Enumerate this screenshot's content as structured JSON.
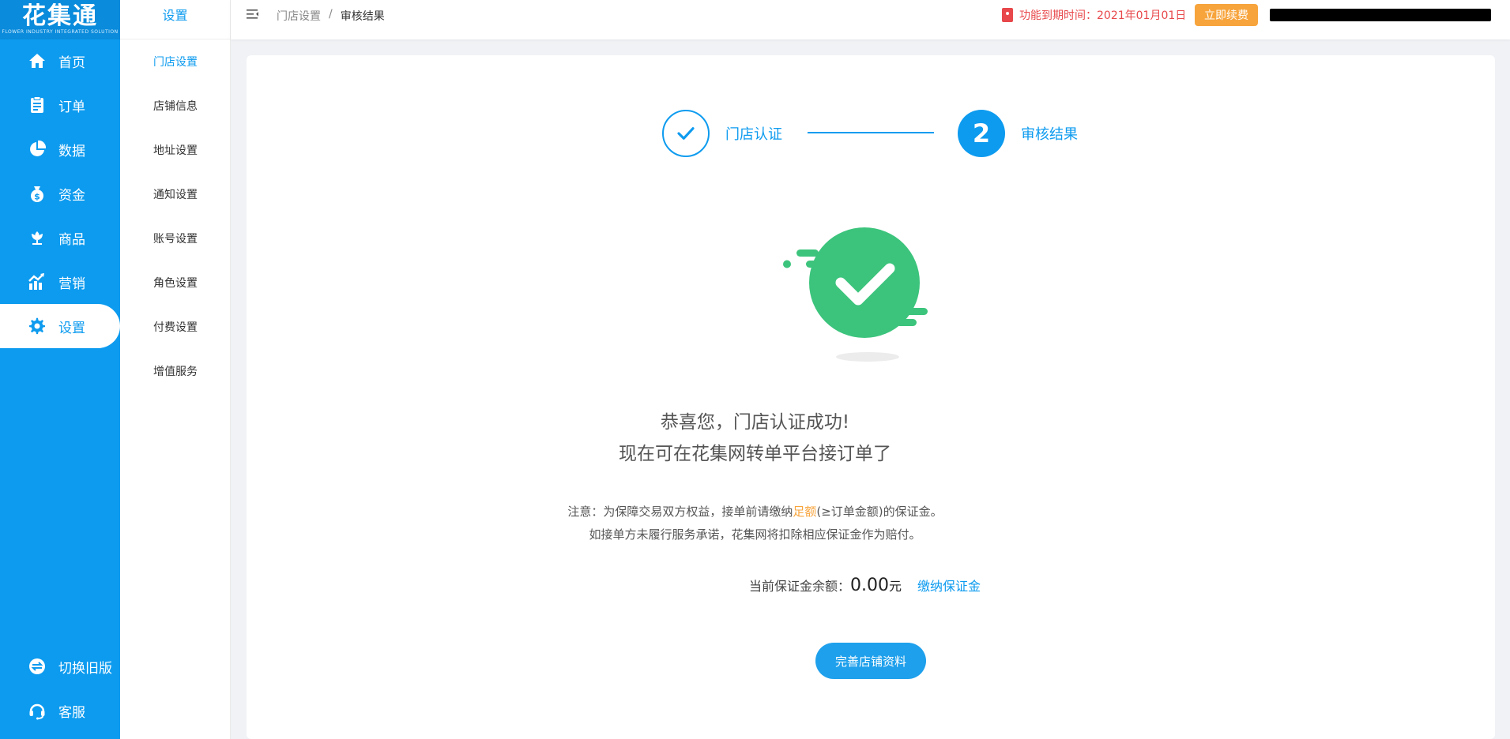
{
  "brand": {
    "logo_text": "花集通",
    "logo_sub": "FLOWER INDUSTRY INTEGRATED SOLUTION"
  },
  "sidebar": {
    "items": [
      {
        "label": "首页",
        "icon": "home-icon"
      },
      {
        "label": "订单",
        "icon": "order-icon"
      },
      {
        "label": "数据",
        "icon": "pie-chart-icon"
      },
      {
        "label": "资金",
        "icon": "money-bag-icon"
      },
      {
        "label": "商品",
        "icon": "flower-icon"
      },
      {
        "label": "营销",
        "icon": "trend-chart-icon"
      },
      {
        "label": "设置",
        "icon": "gear-icon",
        "active": true
      }
    ],
    "bottom": [
      {
        "label": "切换旧版",
        "icon": "switch-icon"
      },
      {
        "label": "客服",
        "icon": "headset-icon"
      }
    ]
  },
  "subnav": {
    "title": "设置",
    "items": [
      "门店设置",
      "店铺信息",
      "地址设置",
      "通知设置",
      "账号设置",
      "角色设置",
      "付费设置",
      "增值服务"
    ]
  },
  "header": {
    "breadcrumb": [
      "门店设置",
      "审核结果"
    ],
    "breadcrumb_sep": "/",
    "expire_text": "功能到期时间：2021年01月01日",
    "renew_label": "立即续费"
  },
  "steps": {
    "step1_label": "门店认证",
    "step2_number": "2",
    "step2_label": "审核结果"
  },
  "result": {
    "title_line1": "恭喜您，门店认证成功!",
    "title_line2": "现在可在花集网转单平台接订单了",
    "note_prefix": "注意：为保障交易双方权益，接单前请缴纳",
    "note_highlight": "足额",
    "note_suffix": "(≥订单金额)的保证金。",
    "note_line2": "如接单方未履行服务承诺，花集网将扣除相应保证金作为赔付。",
    "balance_label": "当前保证金余额：",
    "balance_amount": "0.00",
    "balance_unit": "元",
    "pay_link": "缴纳保证金",
    "complete_button": "完善店铺资料"
  },
  "colors": {
    "primary": "#0d9bef",
    "success": "#3cc47c",
    "warning": "#f7a43c",
    "danger": "#e8484b"
  }
}
